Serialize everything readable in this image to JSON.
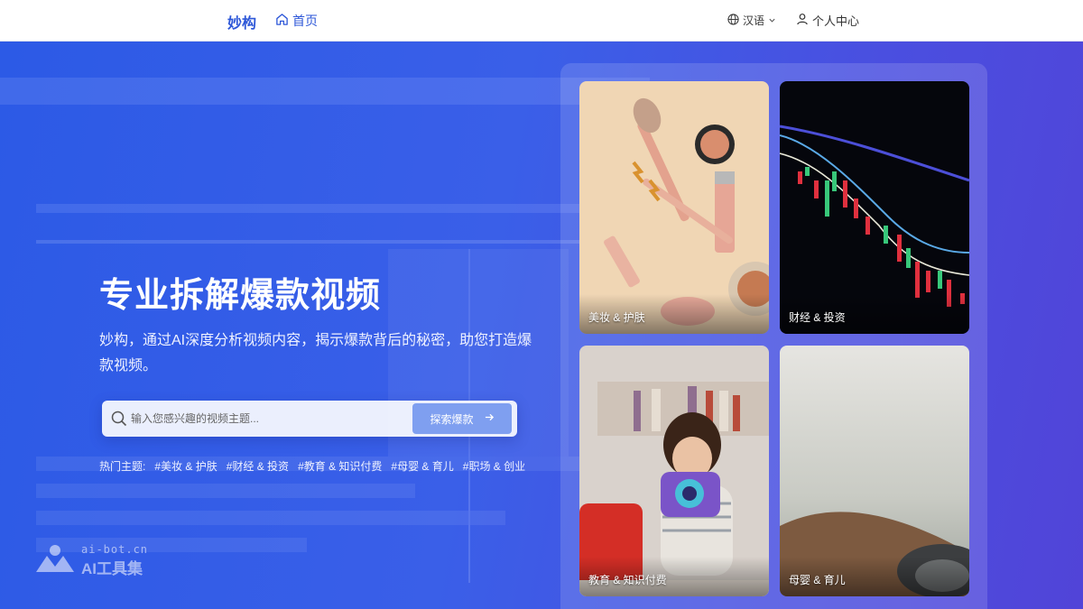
{
  "nav": {
    "brand": "妙构",
    "home_label": "首页",
    "lang_label": "汉语",
    "user_label": "个人中心"
  },
  "hero": {
    "title": "专业拆解爆款视频",
    "description": "妙构，通过AI深度分析视频内容，揭示爆款背后的秘密，助您打造爆款视频。"
  },
  "search": {
    "placeholder": "输入您感兴趣的视频主题...",
    "button_label": "探索爆款"
  },
  "hot_topics": {
    "label": "热门主题:",
    "tags": [
      "#美妆 & 护肤",
      "#财经 & 投资",
      "#教育 & 知识付费",
      "#母婴 & 育儿",
      "#职场 & 创业"
    ]
  },
  "cards": [
    {
      "label": "美妆 & 护肤"
    },
    {
      "label": "财经 & 投资"
    },
    {
      "label": "教育 & 知识付费"
    },
    {
      "label": "母婴 & 育儿"
    }
  ],
  "watermark": {
    "domain": "ai-bot.cn",
    "name": "AI工具集"
  },
  "colors": {
    "brand": "#2d57d8",
    "hero_start": "#2c5ae6",
    "hero_end": "#5144d8",
    "button": "#7f9ff0"
  }
}
